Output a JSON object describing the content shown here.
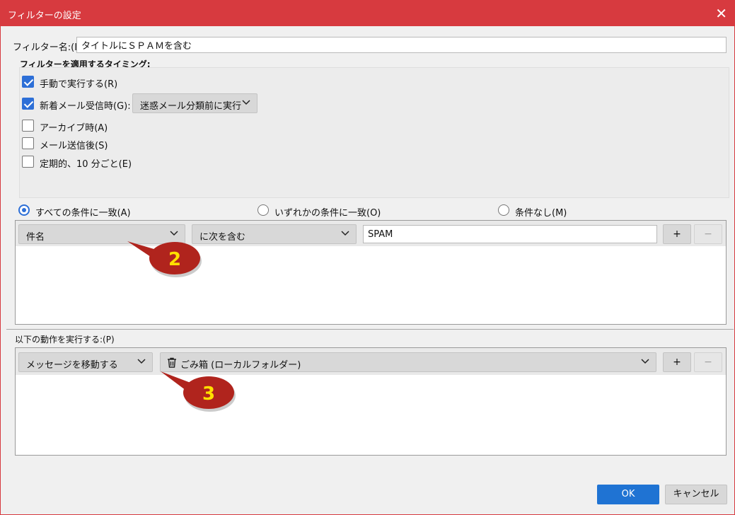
{
  "window": {
    "title": "フィルターの設定",
    "close_icon": "close-icon"
  },
  "filter_name": {
    "label": "フィルター名:(I)",
    "value": "タイトルにＳＰＡＭを含む"
  },
  "timing": {
    "heading": "フィルターを適用するタイミング:",
    "options": [
      {
        "label": "手動で実行する(R)",
        "checked": true
      },
      {
        "label": "新着メール受信時(G):",
        "checked": true
      },
      {
        "label": "アーカイブ時(A)",
        "checked": false
      },
      {
        "label": "メール送信後(S)",
        "checked": false
      },
      {
        "label": "定期的、10 分ごと(E)",
        "checked": false
      }
    ],
    "incoming_mode": "迷惑メール分類前に実行"
  },
  "match": {
    "all": "すべての条件に一致(A)",
    "any": "いずれかの条件に一致(O)",
    "none": "条件なし(M)",
    "selected": "all"
  },
  "condition": {
    "field": "件名",
    "operator": "に次を含む",
    "value": "SPAM",
    "add": "+",
    "remove": "−"
  },
  "actions": {
    "heading": "以下の動作を実行する:(P)",
    "action": "メッセージを移動する",
    "target": "ごみ箱 (ローカルフォルダー)",
    "target_icon": "trash-icon",
    "add": "+",
    "remove": "−"
  },
  "callouts": [
    "2",
    "3"
  ],
  "footer": {
    "ok": "OK",
    "cancel": "キャンセル"
  },
  "colors": {
    "accent": "#d73a3f",
    "primary": "#1f73d3",
    "checkbox": "#2d6fd7",
    "callout": "#b0241d",
    "callout_text": "#ffe000"
  }
}
